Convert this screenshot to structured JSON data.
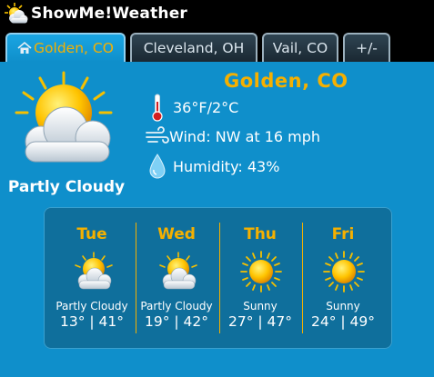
{
  "app": {
    "title": "ShowMe!Weather",
    "icon": "partly-cloudy-app-icon"
  },
  "tabs": [
    {
      "label": "Golden, CO",
      "active": true,
      "icon": "home-icon"
    },
    {
      "label": "Cleveland, OH",
      "active": false
    },
    {
      "label": "Vail, CO",
      "active": false
    },
    {
      "label": "+/-",
      "active": false
    }
  ],
  "current": {
    "city": "Golden, CO",
    "condition": "Partly Cloudy",
    "condition_icon": "partly-cloudy-icon",
    "temperature": "36°F/2°C",
    "wind": "Wind: NW at 16 mph",
    "humidity": "Humidity: 43%"
  },
  "forecast": [
    {
      "day": "Tue",
      "condition": "Partly Cloudy",
      "temps": "13° | 41°",
      "icon": "partly-cloudy"
    },
    {
      "day": "Wed",
      "condition": "Partly Cloudy",
      "temps": "19° | 42°",
      "icon": "partly-cloudy"
    },
    {
      "day": "Thu",
      "condition": "Sunny",
      "temps": "27° | 47°",
      "icon": "sunny"
    },
    {
      "day": "Fri",
      "condition": "Sunny",
      "temps": "24° | 49°",
      "icon": "sunny"
    }
  ],
  "colors": {
    "accent": "#f5b000",
    "background": "#0f8fcb",
    "panel": "#0f6f9c",
    "titlebar": "#000000"
  }
}
